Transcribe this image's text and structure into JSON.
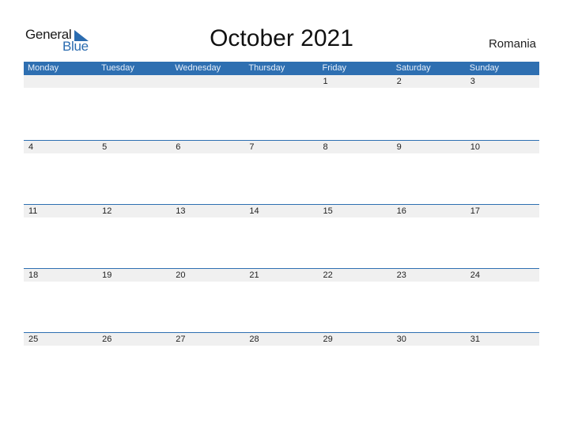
{
  "logo": {
    "word1": "General",
    "word2": "Blue"
  },
  "title": "October 2021",
  "country": "Romania",
  "colors": {
    "accent": "#2e6fb1",
    "row_bg": "#f0f0f0"
  },
  "weekdays": [
    "Monday",
    "Tuesday",
    "Wednesday",
    "Thursday",
    "Friday",
    "Saturday",
    "Sunday"
  ],
  "weeks": [
    [
      "",
      "",
      "",
      "",
      "1",
      "2",
      "3"
    ],
    [
      "4",
      "5",
      "6",
      "7",
      "8",
      "9",
      "10"
    ],
    [
      "11",
      "12",
      "13",
      "14",
      "15",
      "16",
      "17"
    ],
    [
      "18",
      "19",
      "20",
      "21",
      "22",
      "23",
      "24"
    ],
    [
      "25",
      "26",
      "27",
      "28",
      "29",
      "30",
      "31"
    ]
  ]
}
